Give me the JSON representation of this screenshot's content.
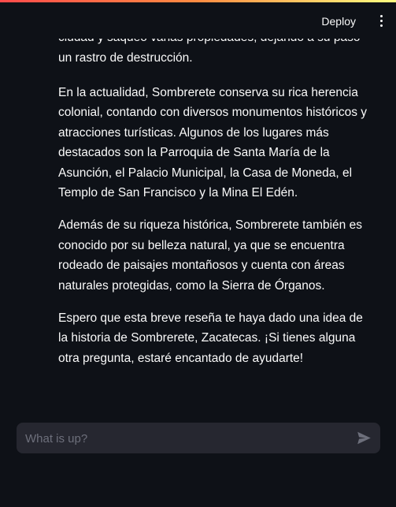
{
  "header": {
    "deploy_label": "Deploy",
    "menu_icon": "vertical-ellipsis-icon"
  },
  "accent": {
    "gradient": [
      "#ff4b4b",
      "#ff8c42",
      "#fffd80"
    ]
  },
  "chat": {
    "paragraphs": [
      "ciudad y saqueó varias propiedades, dejando a su paso un rastro de destrucción.",
      "En la actualidad, Sombrerete conserva su rica herencia colonial, contando con diversos monumentos históricos y atracciones turísticas. Algunos de los lugares más destacados son la Parroquia de Santa María de la Asunción, el Palacio Municipal, la Casa de Moneda, el Templo de San Francisco y la Mina El Edén.",
      "Además de su riqueza histórica, Sombrerete también es conocido por su belleza natural, ya que se encuentra rodeado de paisajes montañosos y cuenta con áreas naturales protegidas, como la Sierra de Órganos.",
      "Espero que esta breve reseña te haya dado una idea de la historia de Sombrerete, Zacatecas. ¡Si tienes alguna otra pregunta, estaré encantado de ayudarte!"
    ]
  },
  "input": {
    "placeholder": "What is up?",
    "value": "",
    "send_icon": "send-icon"
  },
  "colors": {
    "background": "#0e1117",
    "input_background": "#262730",
    "text": "#fafafa",
    "placeholder": "#6d6f7b"
  }
}
